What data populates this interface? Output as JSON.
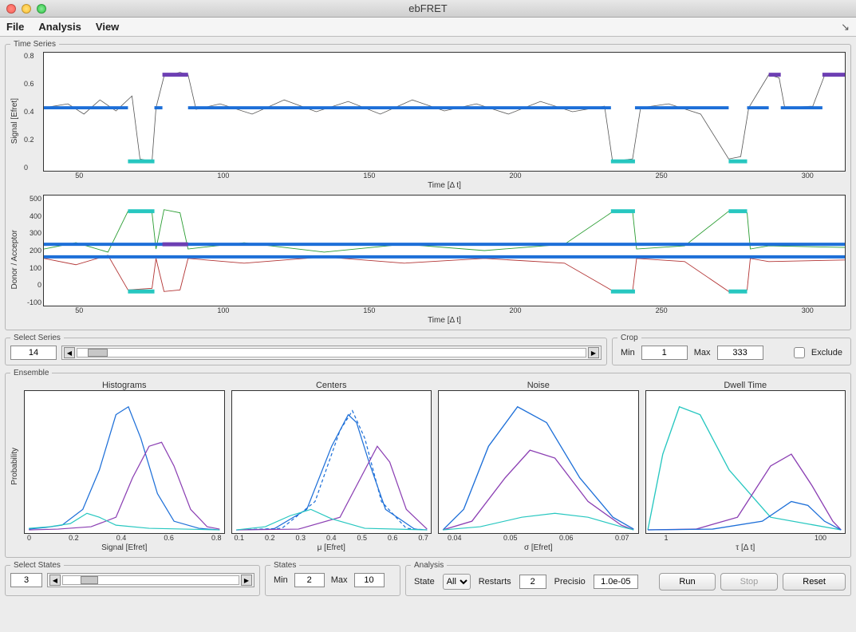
{
  "window": {
    "title": "ebFRET"
  },
  "menu": {
    "file": "File",
    "analysis": "Analysis",
    "view": "View"
  },
  "panels": {
    "timeseries": {
      "legend": "Time Series",
      "top": {
        "ylabel": "Signal [Efret]",
        "xlabel": "Time [Δ t]",
        "yticks": [
          "0",
          "0.2",
          "0.4",
          "0.6",
          "0.8"
        ],
        "xticks": [
          "50",
          "100",
          "150",
          "200",
          "250",
          "300"
        ]
      },
      "bottom": {
        "ylabel": "Donor / Acceptor",
        "xlabel": "Time [Δ t]",
        "yticks": [
          "-100",
          "0",
          "100",
          "200",
          "300",
          "400",
          "500"
        ],
        "xticks": [
          "50",
          "100",
          "150",
          "200",
          "250",
          "300"
        ]
      }
    },
    "select_series": {
      "legend": "Select Series",
      "value": "14"
    },
    "crop": {
      "legend": "Crop",
      "min_label": "Min",
      "min": "1",
      "max_label": "Max",
      "max": "333",
      "exclude_label": "Exclude"
    },
    "ensemble": {
      "legend": "Ensemble",
      "ylabel": "Probability",
      "cols": [
        {
          "title": "Histograms",
          "xlabel": "Signal [Efret]",
          "xticks": [
            "0",
            "0.2",
            "0.4",
            "0.6",
            "0.8"
          ]
        },
        {
          "title": "Centers",
          "xlabel": "μ [Efret]",
          "xticks": [
            "0.1",
            "0.2",
            "0.3",
            "0.4",
            "0.5",
            "0.6",
            "0.7"
          ]
        },
        {
          "title": "Noise",
          "xlabel": "σ [Efret]",
          "xticks": [
            "0.04",
            "0.05",
            "0.06",
            "0.07"
          ]
        },
        {
          "title": "Dwell Time",
          "xlabel": "τ [Δ t]",
          "xticks": [
            "1",
            "100"
          ]
        }
      ]
    },
    "select_states": {
      "legend": "Select States",
      "value": "3"
    },
    "states": {
      "legend": "States",
      "min_label": "Min",
      "min": "2",
      "max_label": "Max",
      "max": "10"
    },
    "analysis_panel": {
      "legend": "Analysis",
      "state_label": "State",
      "state_value": "All",
      "restarts_label": "Restarts",
      "restarts": "2",
      "precision_label": "Precisio",
      "precision": "1.0e-05",
      "run": "Run",
      "stop": "Stop",
      "reset": "Reset"
    }
  },
  "chart_data": {
    "time_series_top": {
      "type": "line",
      "xlabel": "Time [Δ t]",
      "ylabel": "Signal [Efret]",
      "xlim": [
        0,
        333
      ],
      "ylim": [
        -0.1,
        0.8
      ],
      "state_segments": [
        {
          "state": 0.4,
          "from": 0,
          "to": 35
        },
        {
          "state": -0.05,
          "from": 35,
          "to": 46
        },
        {
          "state": 0.4,
          "from": 46,
          "to": 48
        },
        {
          "state": 0.6,
          "from": 48,
          "to": 60
        },
        {
          "state": 0.4,
          "from": 60,
          "to": 236
        },
        {
          "state": -0.05,
          "from": 236,
          "to": 246
        },
        {
          "state": 0.4,
          "from": 246,
          "to": 285
        },
        {
          "state": -0.05,
          "from": 285,
          "to": 292
        },
        {
          "state": 0.4,
          "from": 292,
          "to": 303
        },
        {
          "state": 0.6,
          "from": 303,
          "to": 308
        },
        {
          "state": 0.4,
          "from": 308,
          "to": 325
        },
        {
          "state": 0.6,
          "from": 325,
          "to": 333
        }
      ]
    },
    "time_series_bottom": {
      "type": "line",
      "xlabel": "Time [Δ t]",
      "ylabel": "Donor / Acceptor",
      "xlim": [
        0,
        333
      ],
      "ylim": [
        -100,
        500
      ],
      "state_levels": [
        170,
        230,
        430,
        -20
      ]
    },
    "ensemble": [
      {
        "type": "line",
        "title": "Histograms",
        "xlabel": "Signal [Efret]",
        "ylabel": "Probability",
        "xlim": [
          -0.05,
          0.85
        ]
      },
      {
        "type": "line",
        "title": "Centers",
        "xlabel": "μ [Efret]",
        "xlim": [
          0.05,
          0.75
        ]
      },
      {
        "type": "line",
        "title": "Noise",
        "xlabel": "σ [Efret]",
        "xlim": [
          0.035,
          0.075
        ]
      },
      {
        "type": "line",
        "title": "Dwell Time",
        "xlabel": "τ [Δ t]",
        "xscale": "log",
        "xlim": [
          0.5,
          500
        ]
      }
    ]
  }
}
